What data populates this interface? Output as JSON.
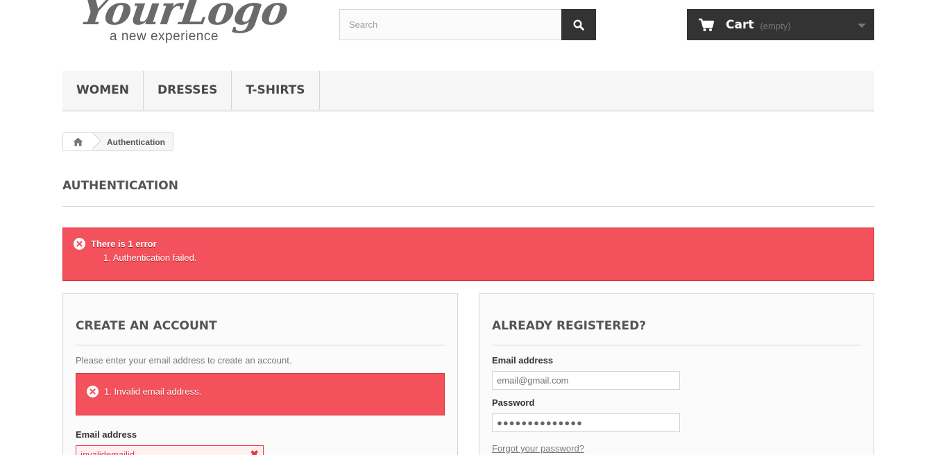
{
  "logo": {
    "script_text": "YourLogo",
    "tagline": "a new experience"
  },
  "search": {
    "placeholder": "Search",
    "icon": "search-icon"
  },
  "cart": {
    "label": "Cart",
    "status": "(empty)",
    "icon": "shopping-cart-icon"
  },
  "menu": {
    "items": [
      {
        "label": "WOMEN"
      },
      {
        "label": "DRESSES"
      },
      {
        "label": "T-SHIRTS"
      }
    ]
  },
  "breadcrumb": {
    "home_icon": "home-icon",
    "current": "Authentication"
  },
  "page": {
    "title": "AUTHENTICATION"
  },
  "top_alert": {
    "title": "There is 1 error",
    "message": "1. Authentication failed.",
    "icon": "error-circle-icon"
  },
  "create_account": {
    "heading": "CREATE AN ACCOUNT",
    "intro": "Please enter your email address to create an account.",
    "alert_message": "1. Invalid email address.",
    "email_label": "Email address",
    "email_value": "invalidemailid"
  },
  "login": {
    "heading": "ALREADY REGISTERED?",
    "email_label": "Email address",
    "email_placeholder": "email@gmail.com",
    "password_label": "Password",
    "password_mask": "●●●●●●●●●●●●●●",
    "forgot_link": "Forgot your password?"
  },
  "colors": {
    "error": "#f3515c",
    "dark": "#333333",
    "menu_bg": "#f6f6f6"
  }
}
